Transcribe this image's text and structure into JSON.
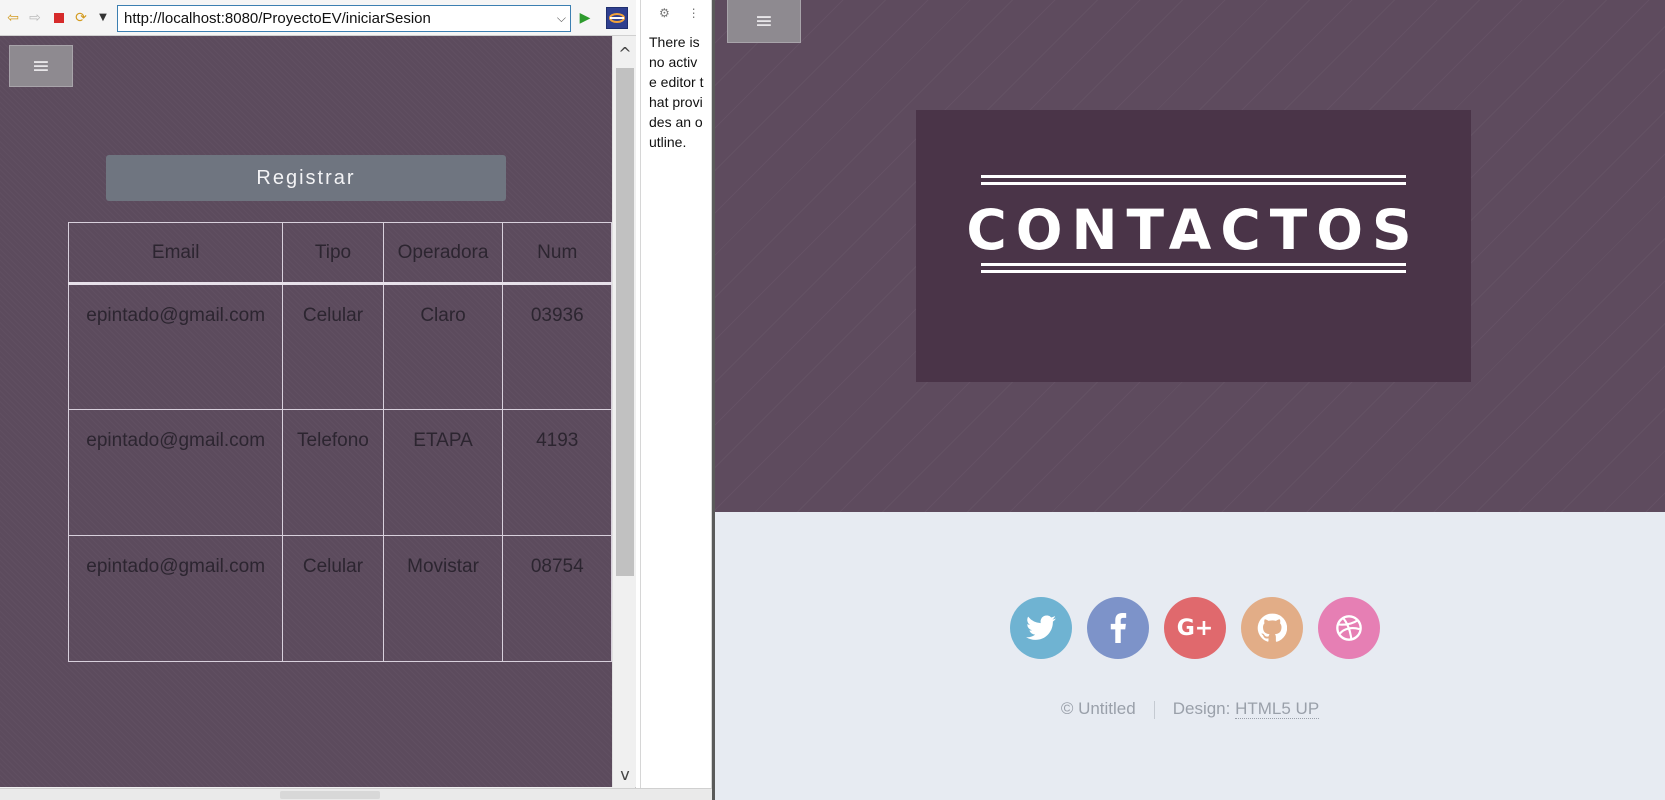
{
  "browser": {
    "url": "http://localhost:8080/ProyectoEV/iniciarSesion",
    "register_label": "Registrar",
    "menu_glyph": "≡",
    "table": {
      "headers": [
        "Email",
        "Tipo",
        "Operadora",
        "Num"
      ],
      "rows": [
        {
          "email": "epintado@gmail.com",
          "tipo": "Celular",
          "operadora": "Claro",
          "numero": "03936"
        },
        {
          "email": "epintado@gmail.com",
          "tipo": "Telefono",
          "operadora": "ETAPA",
          "numero": "4193"
        },
        {
          "email": "epintado@gmail.com",
          "tipo": "Celular",
          "operadora": "Movistar",
          "numero": "08754"
        }
      ]
    }
  },
  "outline": {
    "message": "There is no active editor that provides an outline."
  },
  "page": {
    "menu_glyph": "≡",
    "title": "CONTACTOS",
    "social": [
      {
        "icon": "twitter-icon",
        "color": "#6fb3d2"
      },
      {
        "icon": "facebook-icon",
        "color": "#7d93c9"
      },
      {
        "icon": "google-plus-icon",
        "color": "#e0696d"
      },
      {
        "icon": "github-icon",
        "color": "#e2ad87"
      },
      {
        "icon": "dribbble-icon",
        "color": "#e67fb4"
      }
    ],
    "copyright": "© Untitled",
    "design_prefix": "Design:",
    "design_link": "HTML5 UP"
  }
}
